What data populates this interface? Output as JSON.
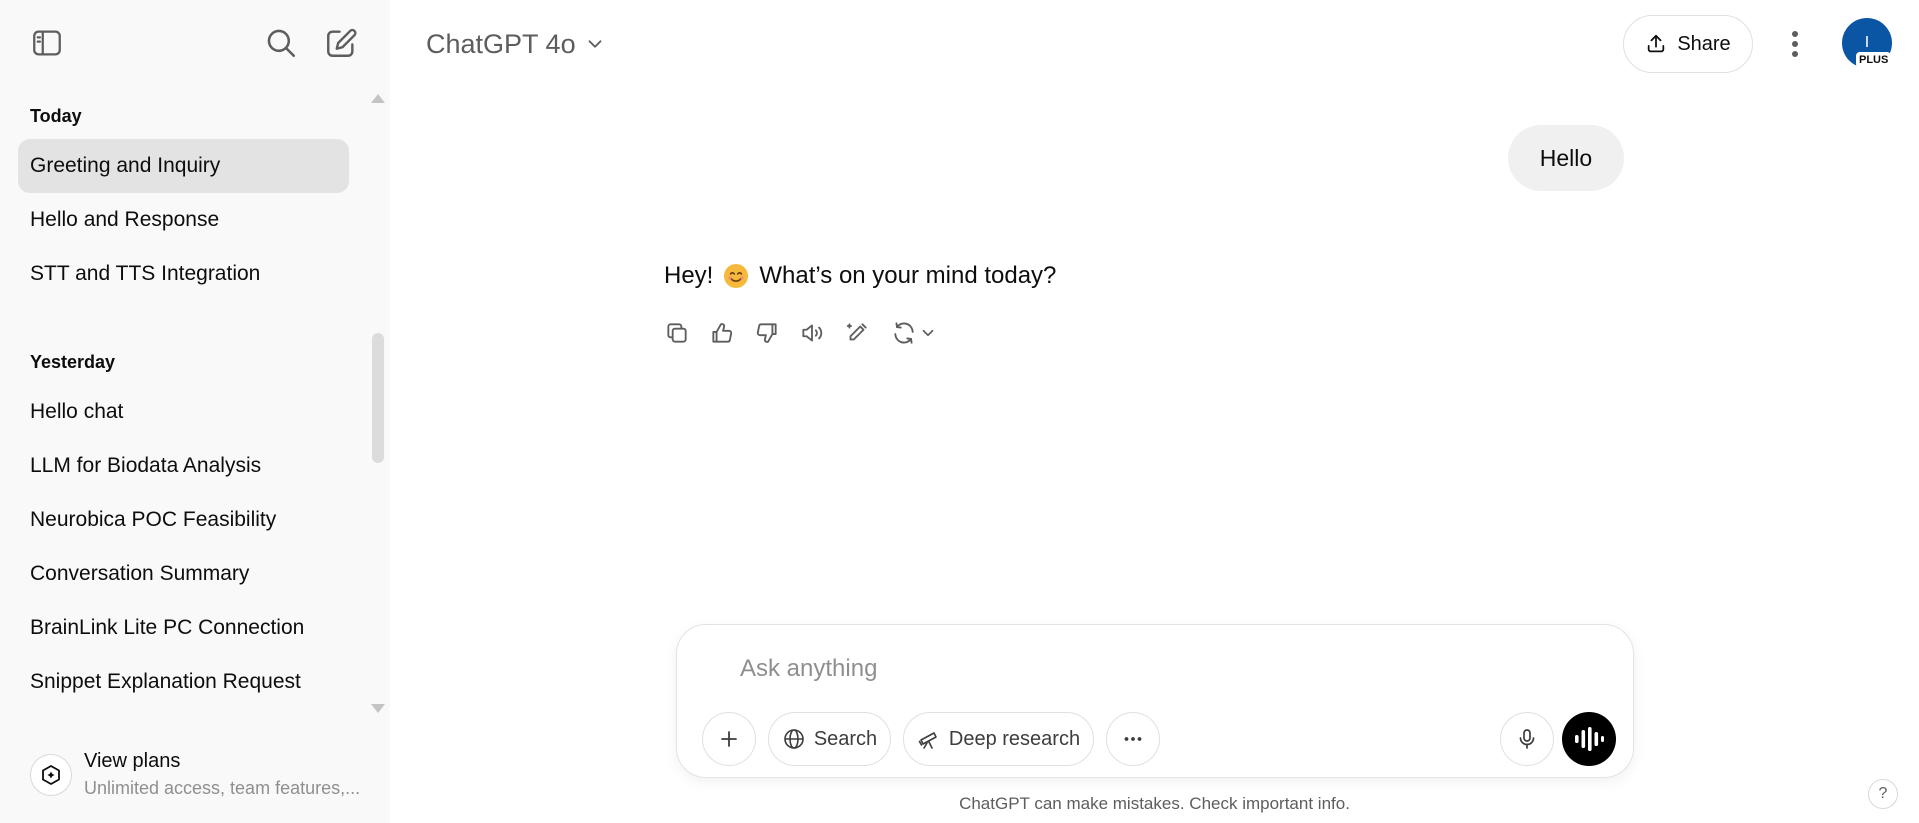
{
  "header": {
    "model_label": "ChatGPT 4o",
    "share_label": "Share",
    "avatar_initial": "I",
    "plan_badge": "PLUS"
  },
  "sidebar": {
    "sections": [
      {
        "label": "Today",
        "items": [
          {
            "label": "Greeting and Inquiry",
            "active": true
          },
          {
            "label": "Hello and Response"
          },
          {
            "label": "STT and TTS Integration"
          }
        ]
      },
      {
        "label": "Yesterday",
        "items": [
          {
            "label": "Hello chat"
          },
          {
            "label": "LLM for Biodata Analysis"
          },
          {
            "label": "Neurobica POC Feasibility"
          },
          {
            "label": "Conversation Summary"
          },
          {
            "label": "BrainLink Lite PC Connection"
          },
          {
            "label": "Snippet Explanation Request"
          }
        ]
      }
    ],
    "view_plans": {
      "title": "View plans",
      "subtitle": "Unlimited access, team features,..."
    }
  },
  "conversation": {
    "user_message": "Hello",
    "assistant_prefix": "Hey!",
    "assistant_suffix": "What’s on your mind today?",
    "emoji_icon": "smiling-face-emoji"
  },
  "composer": {
    "placeholder": "Ask anything",
    "search_label": "Search",
    "deep_research_label": "Deep research"
  },
  "footer": {
    "disclaimer": "ChatGPT can make mistakes. Check important info.",
    "help_label": "?"
  },
  "colors": {
    "sidebar_bg": "#f9f9f9",
    "active_item_bg": "#e3e3e3",
    "user_bubble_bg": "#f0f0f0",
    "avatar_bg": "#0b56a4",
    "voice_button_bg": "#000000"
  }
}
